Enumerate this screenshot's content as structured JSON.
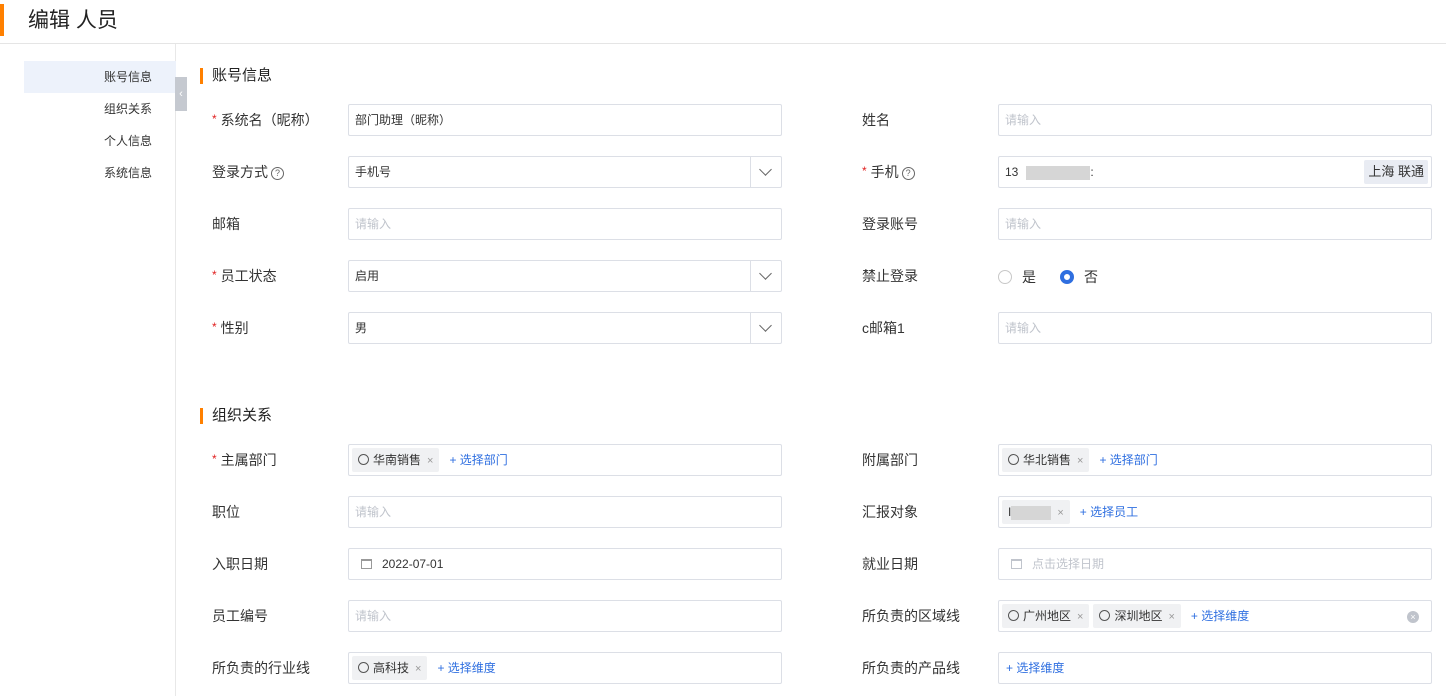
{
  "page": {
    "title": "编辑 人员"
  },
  "sidebar": {
    "items": [
      "账号信息",
      "组织关系",
      "个人信息",
      "系统信息"
    ],
    "collapse_glyph": "‹"
  },
  "sections": {
    "account": "账号信息",
    "org": "组织关系"
  },
  "glyphs": {
    "required": "*",
    "help": "?",
    "tag_remove": "×",
    "clear": "×"
  },
  "colors": {
    "accent": "#ff8000",
    "link": "#2f6fe0",
    "required": "#e02020"
  },
  "account": {
    "nickname": {
      "label": "系统名（昵称）",
      "value": "部门助理（昵称）"
    },
    "name": {
      "label": "姓名",
      "placeholder": "请输入"
    },
    "login_method": {
      "label": "登录方式",
      "value": "手机号"
    },
    "phone": {
      "label": "手机",
      "value_prefix": "13",
      "value_suffix": ":",
      "carrier": "上海 联通"
    },
    "email": {
      "label": "邮箱",
      "placeholder": "请输入"
    },
    "login_account": {
      "label": "登录账号",
      "placeholder": "请输入"
    },
    "status": {
      "label": "员工状态",
      "value": "启用"
    },
    "forbid_login": {
      "label": "禁止登录",
      "options": [
        "是",
        "否"
      ],
      "selected": "否"
    },
    "gender": {
      "label": "性别",
      "value": "男"
    },
    "c_email": {
      "label": "c邮箱1",
      "placeholder": "请输入"
    }
  },
  "org": {
    "main_dept": {
      "label": "主属部门",
      "tags": [
        "华南销售"
      ],
      "add": "+ 选择部门"
    },
    "sub_dept": {
      "label": "附属部门",
      "tags": [
        "华北销售"
      ],
      "add": "+ 选择部门"
    },
    "position": {
      "label": "职位",
      "placeholder": "请输入"
    },
    "report_to": {
      "label": "汇报对象",
      "tag_initial": "I",
      "add": "+ 选择员工"
    },
    "entry_date": {
      "label": "入职日期",
      "value": "2022-07-01"
    },
    "employment_date": {
      "label": "就业日期",
      "placeholder": "点击选择日期"
    },
    "employee_no": {
      "label": "员工编号",
      "placeholder": "请输入"
    },
    "region_line": {
      "label": "所负责的区域线",
      "tags": [
        "广州地区",
        "深圳地区"
      ],
      "add": "+ 选择维度"
    },
    "industry_line": {
      "label": "所负责的行业线",
      "tags": [
        "高科技"
      ],
      "add": "+ 选择维度"
    },
    "product_line": {
      "label": "所负责的产品线",
      "add": "+ 选择维度"
    }
  }
}
